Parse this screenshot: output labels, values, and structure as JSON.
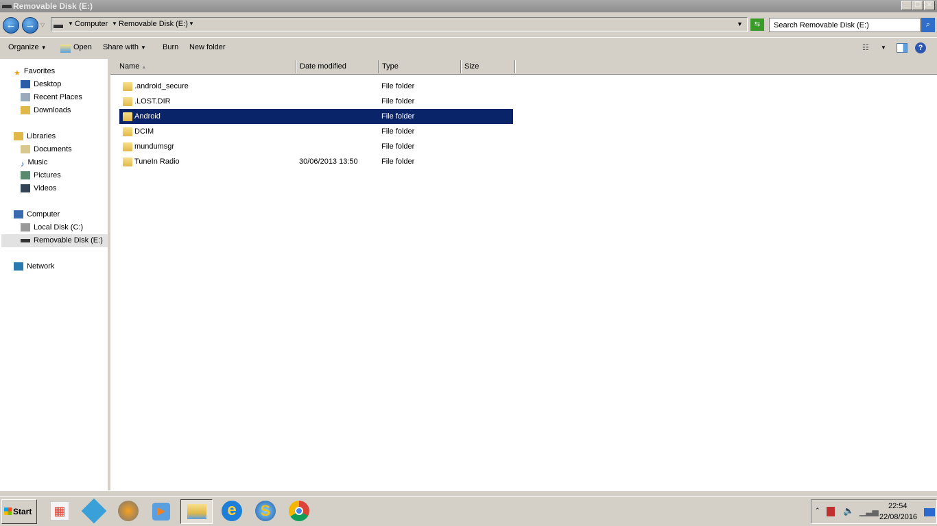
{
  "window": {
    "title": "Removable Disk (E:)"
  },
  "address": {
    "crumbs": [
      "Computer",
      "Removable Disk (E:)"
    ],
    "search_placeholder": "Search Removable Disk (E:)"
  },
  "toolbar": {
    "organize": "Organize",
    "open": "Open",
    "share_with": "Share with",
    "burn": "Burn",
    "new_folder": "New folder"
  },
  "nav": {
    "favorites": "Favorites",
    "desktop": "Desktop",
    "recent": "Recent Places",
    "downloads": "Downloads",
    "libraries": "Libraries",
    "documents": "Documents",
    "music": "Music",
    "pictures": "Pictures",
    "videos": "Videos",
    "computer": "Computer",
    "local_disk": "Local Disk (C:)",
    "removable": "Removable Disk (E:)",
    "network": "Network"
  },
  "columns": {
    "name": "Name",
    "date": "Date modified",
    "type": "Type",
    "size": "Size"
  },
  "files": [
    {
      "name": ".android_secure",
      "date": "",
      "type": "File folder"
    },
    {
      "name": ".LOST.DIR",
      "date": "",
      "type": "File folder"
    },
    {
      "name": "Android",
      "date": "",
      "type": "File folder",
      "selected": true
    },
    {
      "name": "DCIM",
      "date": "",
      "type": "File folder"
    },
    {
      "name": "mundumsgr",
      "date": "",
      "type": "File folder"
    },
    {
      "name": "TuneIn Radio",
      "date": "30/06/2013 13:50",
      "type": "File folder"
    }
  ],
  "taskbar": {
    "start": "Start",
    "time": "22:54",
    "date": "22/08/2016"
  },
  "colors": {
    "selection": "#0a246a",
    "chrome": "#d4d0c8"
  }
}
